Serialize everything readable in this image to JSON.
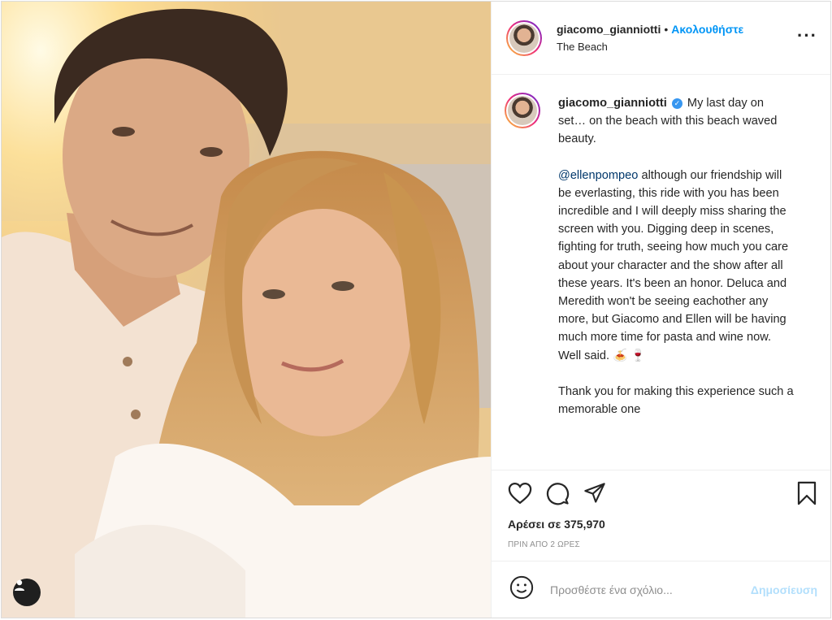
{
  "post": {
    "username": "giacomo_gianniotti",
    "separator": "•",
    "follow_label": "Ακολουθήστε",
    "location": "The Beach",
    "more_icon": "more-horizontal-icon"
  },
  "caption": {
    "username": "giacomo_gianniotti",
    "line1": "My last day on set… on the beach with this beach waved beauty.",
    "mention": "@ellenpompeo",
    "line2": "although our friendship will be everlasting, this ride with you has been incredible and I will deeply miss sharing the screen with you. Digging deep in scenes, fighting for truth, seeing how much you care about your character and the show after all these years. It's been an honor. Deluca and Meredith won't be seeing eachother any more, but Giacomo and Ellen will be having much more time for pasta and wine now. Well said. 🍝 🍷",
    "line3": "Thank you for making this experience such a memorable one"
  },
  "actions": {
    "like_icon": "heart-icon",
    "comment_icon": "comment-icon",
    "share_icon": "share-icon",
    "save_icon": "bookmark-icon",
    "likes_text": "Αρέσει σε 375,970",
    "time_text": "ΠΡΙΝ ΑΠΟ 2 ΩΡΕΣ"
  },
  "composer": {
    "emoji_icon": "emoji-icon",
    "placeholder": "Προσθέστε ένα σχόλιο...",
    "post_label": "Δημοσίευση"
  },
  "photo": {
    "tag_icon": "user-tag-icon"
  }
}
